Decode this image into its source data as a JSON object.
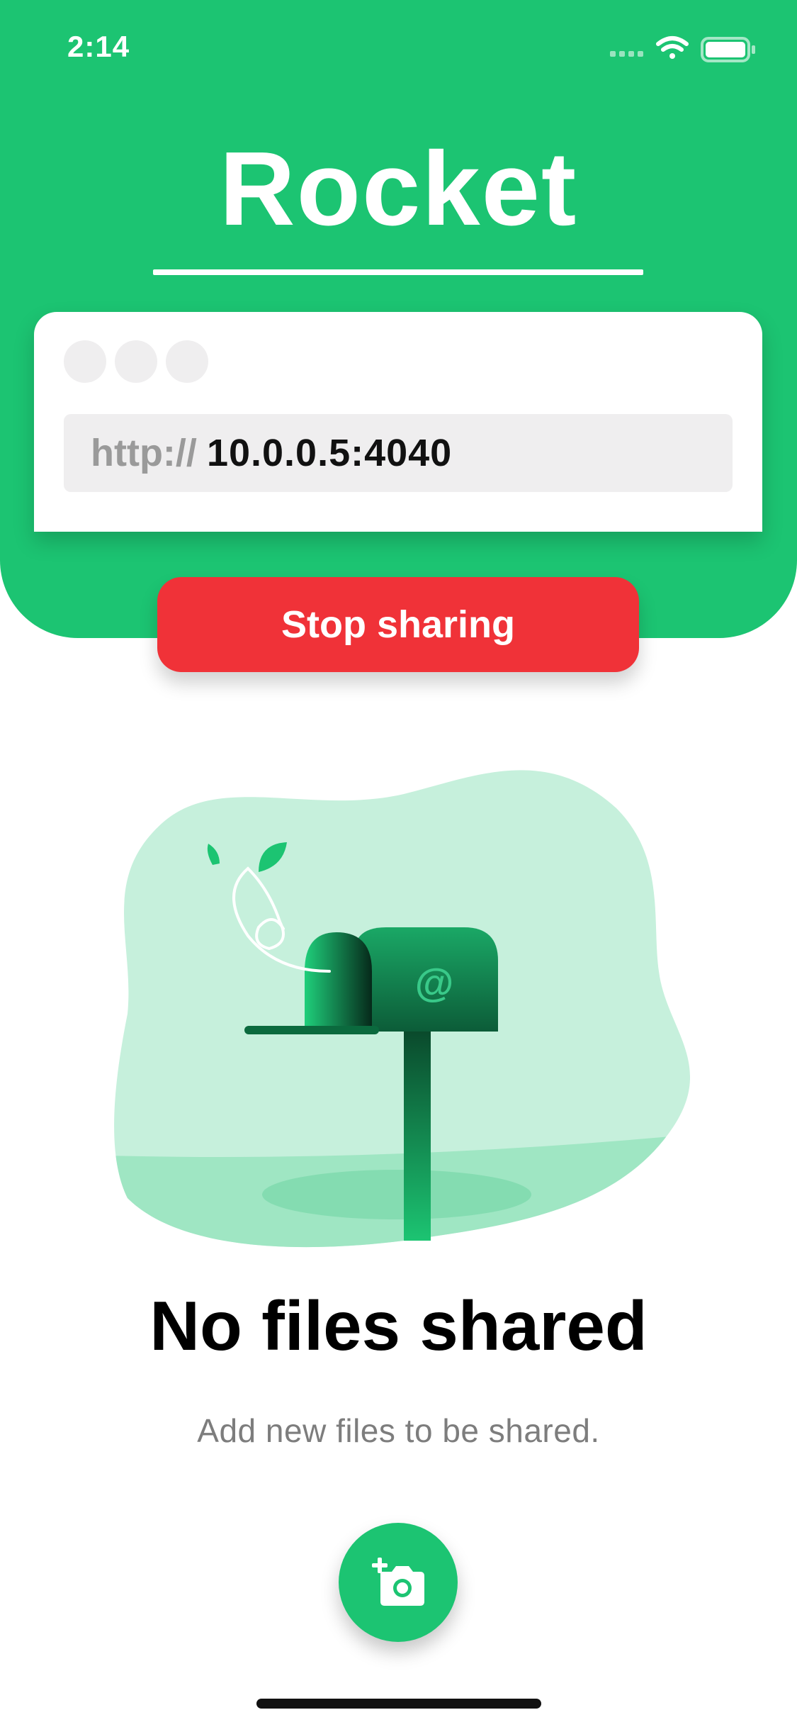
{
  "status_bar": {
    "time": "2:14",
    "signal_icon": "cellular-signal-icon",
    "wifi_icon": "wifi-icon",
    "battery_icon": "battery-icon"
  },
  "header": {
    "title": "Rocket",
    "background_color": "#1cc472"
  },
  "browser_card": {
    "window_dots": [
      "window-dot",
      "window-dot",
      "window-dot"
    ],
    "url_prefix": "http://",
    "url_host": "10.0.0.5:4040"
  },
  "stop_button": {
    "label": "Stop sharing",
    "color": "#f03238"
  },
  "empty_state": {
    "illustration": "mailbox-illustration",
    "mailbox_symbol": "@",
    "title": "No files shared",
    "subtitle": "Add new files to be shared."
  },
  "fab": {
    "icon": "add-photo-icon"
  }
}
